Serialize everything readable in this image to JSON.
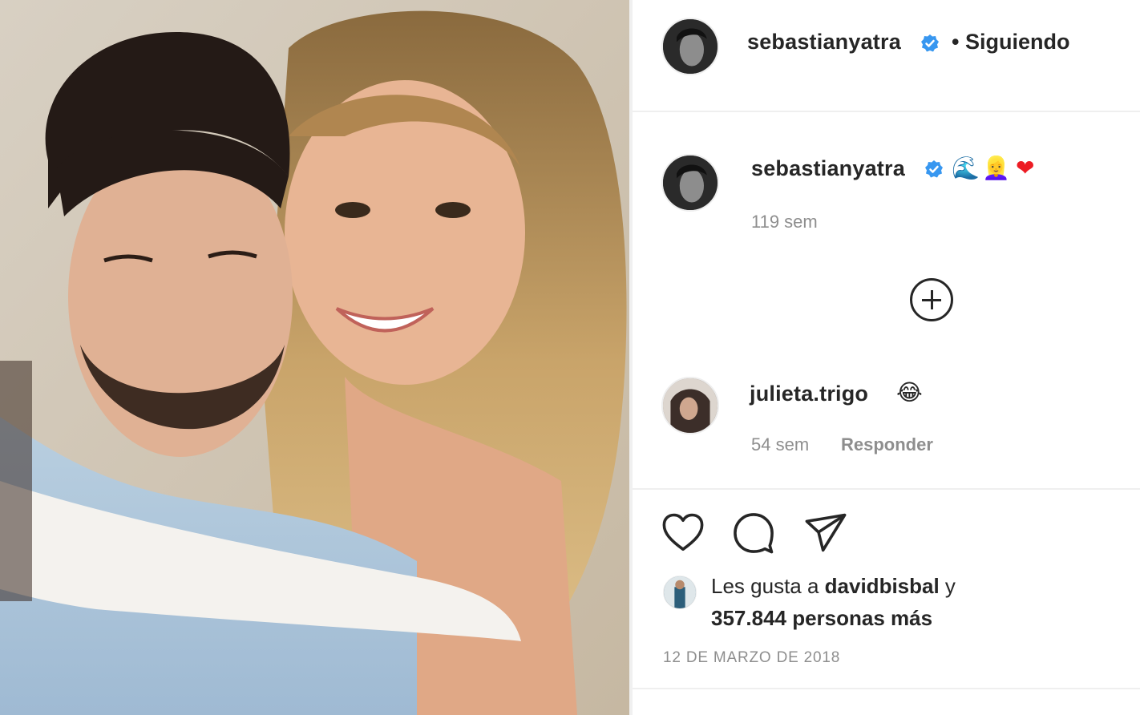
{
  "post": {
    "author": "sebastianyatra",
    "follow_status": "• Siguiendo",
    "caption_author": "sebastianyatra",
    "caption_emojis": [
      "🌊",
      "👱‍♀️",
      "❤"
    ],
    "caption_time": "119 sem",
    "comments": [
      {
        "user": "julieta.trigo",
        "emoji": "😂",
        "time": "54 sem",
        "reply_label": "Responder"
      }
    ],
    "likes": {
      "prefix": "Les gusta a ",
      "liker": "davidbisbal",
      "conjunction": " y",
      "others": "357.844 personas más"
    },
    "date": "12 DE MARZO DE 2018"
  },
  "icons": [
    "verified-badge-icon",
    "add-comment-icon",
    "heart-icon",
    "comment-icon",
    "share-icon"
  ],
  "colors": {
    "text": "#262626",
    "muted": "#8e8e8e",
    "verified_blue": "#3897f0",
    "heart_red": "#ed1c24"
  }
}
